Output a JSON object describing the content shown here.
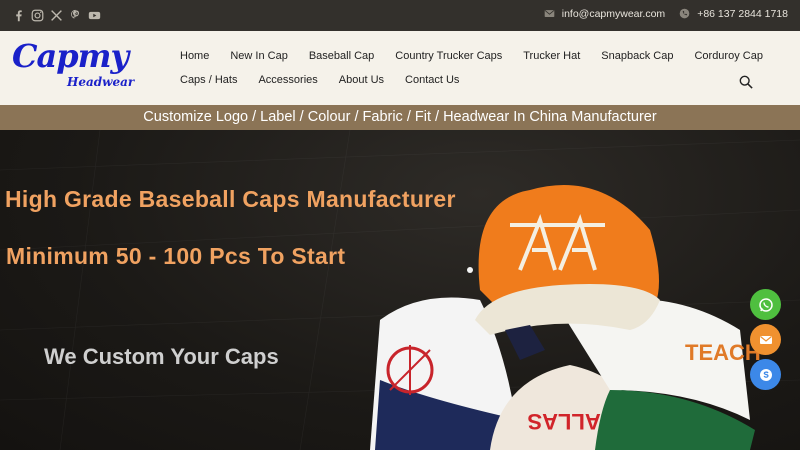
{
  "topbar": {
    "social": [
      "facebook-icon",
      "instagram-icon",
      "x-icon",
      "pinterest-icon",
      "youtube-icon"
    ],
    "email": "info@capmywear.com",
    "phone": "+86 137 2844 1718"
  },
  "logo": {
    "main": "Capmy",
    "sub": "Headwear"
  },
  "nav": {
    "row1": [
      "Home",
      "New In Cap",
      "Baseball Cap",
      "Country Trucker Caps",
      "Trucker Hat",
      "Snapback Cap",
      "Corduroy Cap"
    ],
    "row2": [
      "Caps / Hats",
      "Accessories",
      "About Us",
      "Contact Us"
    ]
  },
  "strip": {
    "text": "Customize Logo / Label / Colour / Fabric / Fit /  Headwear In China Manufacturer"
  },
  "hero": {
    "line1": "High Grade Baseball Caps Manufacturer",
    "line2": "Minimum 50 - 100 Pcs To Start",
    "line3": "We Custom Your Caps",
    "cap_text_front": "DALLAS",
    "cap_text_right": "TEACH"
  },
  "colors": {
    "topbar_bg": "#33302c",
    "header_bg": "#f5f2ea",
    "logo_blue": "#1a21c9",
    "strip_bg": "#8b7456",
    "hero_orange": "#f0a261",
    "whatsapp": "#4fbf3f",
    "mail": "#f0912f",
    "skype": "#3c88e8"
  },
  "floating": [
    "whatsapp-icon",
    "email-icon",
    "skype-icon"
  ]
}
